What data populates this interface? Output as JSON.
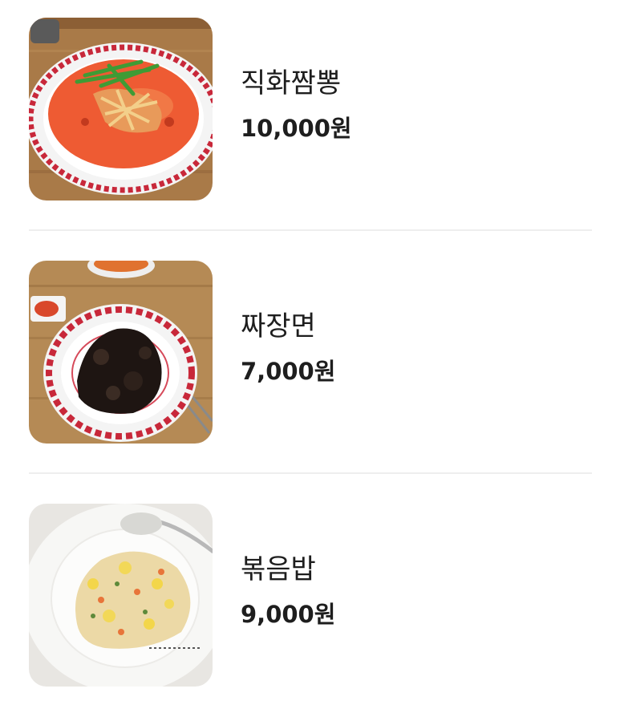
{
  "menu": {
    "items": [
      {
        "name": "직화짬뽕",
        "price": "10,000원",
        "photo_icon": "jjamppong-photo"
      },
      {
        "name": "짜장면",
        "price": "7,000원",
        "photo_icon": "jajangmyeon-photo"
      },
      {
        "name": "볶음밥",
        "price": "9,000원",
        "photo_icon": "fried-rice-photo"
      }
    ]
  },
  "colors": {
    "text": "#1e1e1e",
    "divider": "#eeeeee",
    "soup_red": "#ee5b33",
    "plate_red": "#c8283a",
    "table_wood": "#a97a48"
  }
}
